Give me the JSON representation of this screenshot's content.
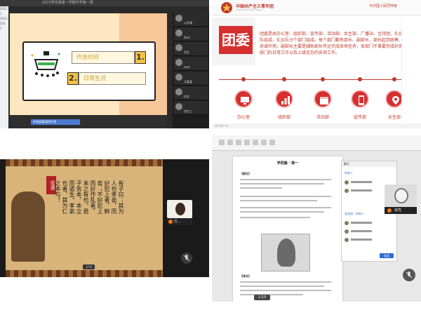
{
  "q1": {
    "titlebar": "2023学年度第一学期开学第一课",
    "left_labels": [
      "2023",
      "1",
      "2023",
      "202",
      "1"
    ],
    "menu": [
      {
        "num": "1.",
        "label": "作息时间"
      },
      {
        "num": "2.",
        "label": "日常生活"
      }
    ],
    "bottom_button": "共享屏幕/暂停共享",
    "participants": [
      "公开课",
      "Dart",
      "学生",
      "Lear",
      "冯某某",
      "红红",
      "学生三"
    ]
  },
  "q2": {
    "logo_text": "中国共产主义青年团",
    "logo_sub": "Communist Youth League",
    "tag": "与中国人民同呼吸",
    "big_title": "团委",
    "paragraph": "团委是由办公室、组织部、宣传部、活动部、女生部、广播站、主持团、礼仪队组成，礼仪队分个部门组成。每个部门都有部长、副部长、部长起到统筹、协调作用，副部长主要是辅助部长传达完成各项任务，各部门干事要完成好各部门的日常工作以及上级交办的各项工作。",
    "departments": [
      "办公室",
      "组织部",
      "活动部",
      "宣传部",
      "女生部"
    ],
    "footer": "幻灯片第 1 张"
  },
  "q3": {
    "seal": "论语",
    "columns": [
      "有子曰：其为",
      "人也孝弟，而",
      "好犯上者，鲜",
      "矣；不好犯上",
      "而好作乱者，",
      "未之有也。君",
      "子务本，本立",
      "而道生。孝弟",
      "也者，其为仁",
      "之本与！"
    ],
    "page": "1/10",
    "participant": "方...",
    "colors": {
      "pattern_dark": "#6b3a1e",
      "body": "#d8b47a"
    }
  },
  "q4": {
    "doc_title": "学而篇 · 第一",
    "heading1": "【原文】",
    "heading2": "【译文】",
    "chat_header": "聊天",
    "chat_link1": "所有人",
    "chat_link2": "发送给：所有人",
    "send": "发送",
    "participant": "谢亮",
    "page": "1/10"
  }
}
